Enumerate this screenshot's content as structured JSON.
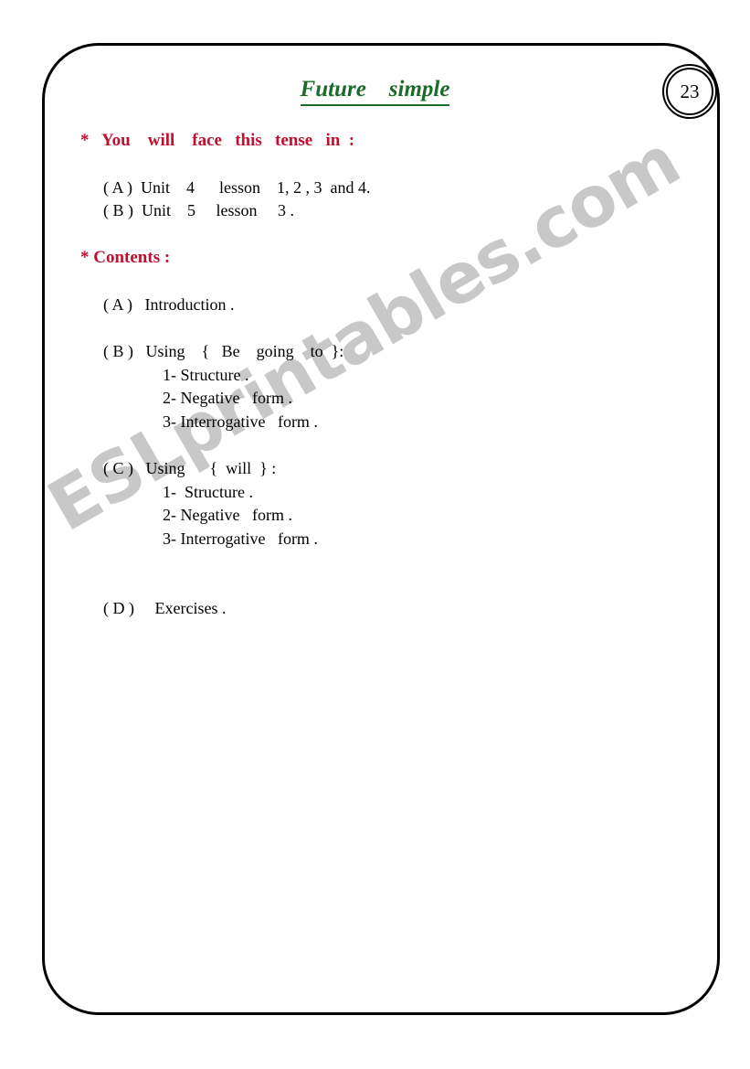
{
  "page": {
    "number": "23",
    "watermark": "ESLprintables.com",
    "colors": {
      "title_green": "#1b6b2b",
      "heading_red": "#c01030",
      "body_black": "#000000",
      "watermark_gray": "#c8c8c8",
      "border_black": "#000000"
    }
  },
  "title": "Future    simple",
  "sections": {
    "face": {
      "heading": "*   You    will    face   this   tense   in  :",
      "items": [
        "( A )  Unit    4      lesson    1, 2 , 3  and 4.",
        "( B )  Unit    5     lesson     3 ."
      ]
    },
    "contents": {
      "heading": "* Contents :",
      "items": [
        {
          "label": "( A )   Introduction .",
          "sub": []
        },
        {
          "label": "( B )   Using    {   Be    going    to  }:",
          "sub": [
            "1- Structure .",
            "2- Negative   form .",
            "3- Interrogative   form ."
          ]
        },
        {
          "label": "( C )   Using      {  will  } :",
          "sub": [
            "1-  Structure .",
            "2- Negative   form .",
            "3- Interrogative   form ."
          ]
        },
        {
          "label": "( D )     Exercises .",
          "sub": []
        }
      ]
    }
  }
}
